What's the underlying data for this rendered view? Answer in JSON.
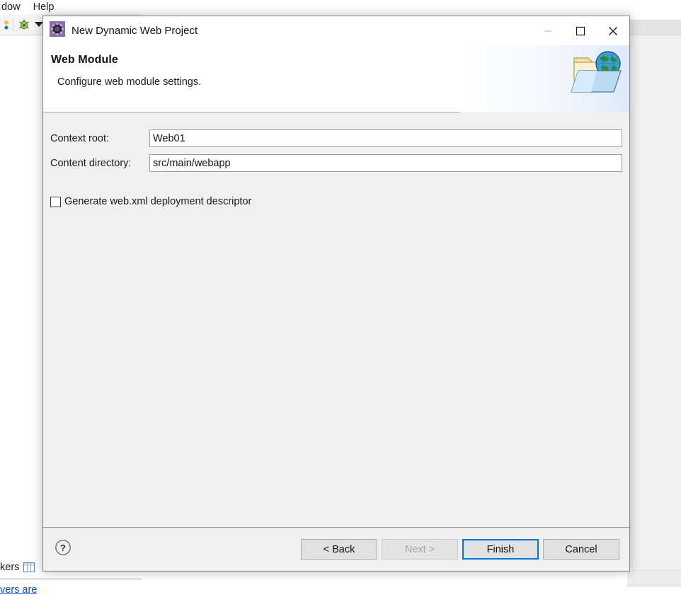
{
  "background": {
    "menubar": [
      {
        "label": "dow",
        "name": "menu-window"
      },
      {
        "label": "Help",
        "name": "menu-help"
      }
    ],
    "toolbar": {
      "run_icon": "run-icon",
      "debug_icon": "debug-bug-icon",
      "dropdown_icon": "chevron-down-icon"
    },
    "bottom_tab": {
      "label": "kers",
      "icon": "markers-table-icon"
    },
    "servers_panel": {
      "link_text": "vers are"
    }
  },
  "dialog": {
    "titlebar": {
      "icon": "eclipse-wizard-gear-icon",
      "title": "New Dynamic Web Project",
      "minimize_label": "minimize-icon",
      "maximize_label": "maximize-icon",
      "close_label": "close-icon"
    },
    "header": {
      "title": "Web Module",
      "description": "Configure web module settings.",
      "banner_icon": "web-project-folder-globe-icon"
    },
    "form": {
      "fields": [
        {
          "name": "context-root",
          "label": "Context root:",
          "value": "Web01",
          "placeholder": ""
        },
        {
          "name": "content-directory",
          "label": "Content directory:",
          "value": "src/main/webapp",
          "placeholder": ""
        }
      ],
      "checkbox": {
        "name": "generate-web-xml",
        "label": "Generate web.xml deployment descriptor",
        "checked": false
      }
    },
    "footer": {
      "help_icon": "help-question-icon",
      "buttons": [
        {
          "name": "back-button",
          "label": "< Back",
          "state": "enabled"
        },
        {
          "name": "next-button",
          "label": "Next >",
          "state": "disabled"
        },
        {
          "name": "finish-button",
          "label": "Finish",
          "state": "default"
        },
        {
          "name": "cancel-button",
          "label": "Cancel",
          "state": "enabled"
        }
      ]
    }
  },
  "colors": {
    "accent_blue": "#0078d7",
    "link_blue": "#0b50c8",
    "dialog_body": "#f0f0f0",
    "title_icon_purple": "#8e6aa8"
  }
}
